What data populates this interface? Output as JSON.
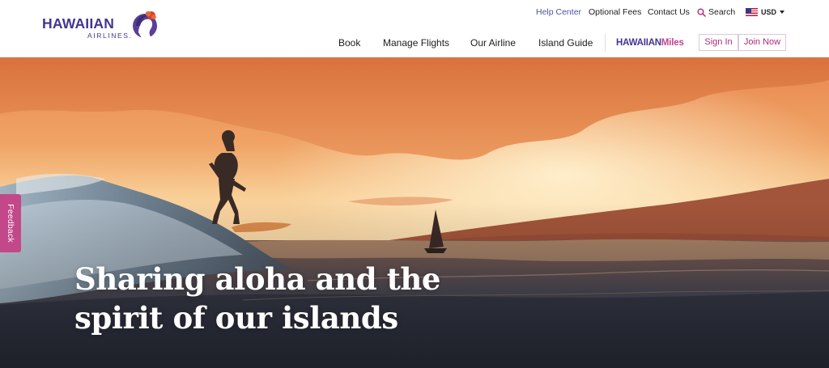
{
  "brand": {
    "name": "HAWAIIAN",
    "sub": "AIRLINES."
  },
  "utility_nav": {
    "help": "Help Center",
    "fees": "Optional Fees",
    "contact": "Contact Us",
    "search": "Search",
    "currency": "USD"
  },
  "main_nav": {
    "items": [
      "Book",
      "Manage Flights",
      "Our Airline",
      "Island Guide"
    ],
    "miles_part1": "HAWAIIAN",
    "miles_part2": "Miles",
    "sign_in": "Sign In",
    "join_now": "Join Now"
  },
  "hero": {
    "headline_line1": "Sharing aloha and the",
    "headline_line2": "spirit of our islands"
  },
  "feedback": "Feedback",
  "icons": {
    "search": "search-icon",
    "currency_flag": "us-flag-icon",
    "caret": "chevron-down-icon",
    "logo": "pualani-logo-icon"
  },
  "colors": {
    "brand_purple": "#413691",
    "brand_magenta": "#b3297b",
    "feedback_pink": "#c2488a"
  }
}
